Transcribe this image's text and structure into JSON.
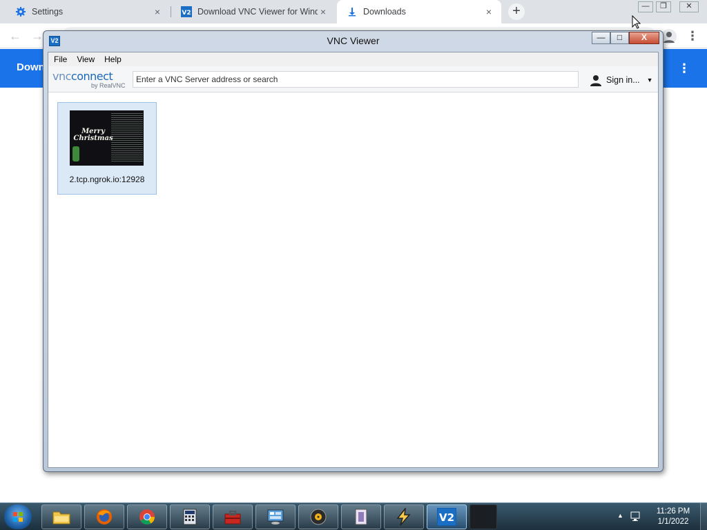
{
  "chrome": {
    "tabs": [
      {
        "title": "Settings",
        "icon": "gear-icon"
      },
      {
        "title": "Download VNC Viewer for Windc",
        "icon": "vnc-icon"
      },
      {
        "title": "Downloads",
        "icon": "download-icon"
      }
    ],
    "tab_close": "×",
    "new_tab": "+",
    "page_title": "Down",
    "accent_color": "#1a73e8"
  },
  "vnc": {
    "window_title": "VNC Viewer",
    "app_icon_text": "V2",
    "controls": {
      "minimize": "—",
      "maximize": "□",
      "close": "X"
    },
    "menu": [
      "File",
      "View",
      "Help"
    ],
    "logo": {
      "main_a": "vnc",
      "main_b": "connect",
      "sub": "by RealVNC"
    },
    "search_placeholder": "Enter a VNC Server address or search",
    "sign_in": "Sign in...",
    "connections": [
      {
        "label": "2.tcp.ngrok.io:12928",
        "thumbnail_text": "Merry Christmas"
      }
    ]
  },
  "taskbar": {
    "apps": [
      "explorer-icon",
      "firefox-icon",
      "chrome-icon",
      "calculator-icon",
      "toolbox-icon",
      "control-panel-icon",
      "media-icon",
      "notepad-icon",
      "winamp-icon",
      "vnc-icon",
      "blank-icon"
    ],
    "clock_time": "11:26 PM",
    "clock_date": "1/1/2022"
  }
}
